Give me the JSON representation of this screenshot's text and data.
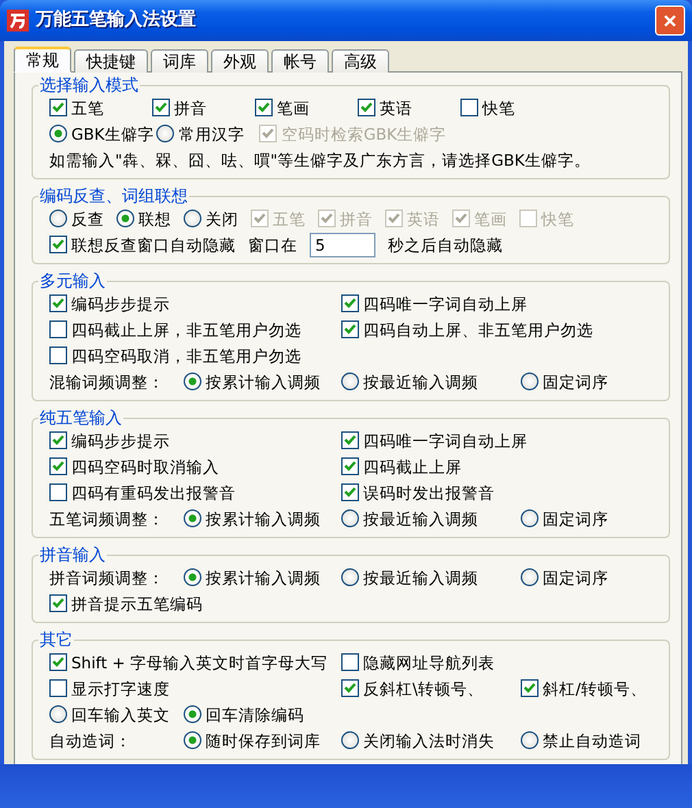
{
  "window": {
    "title": "万能五笔输入法设置",
    "close": "✕"
  },
  "tabs": [
    {
      "label": "常规",
      "selected": true
    },
    {
      "label": "快捷键",
      "selected": false
    },
    {
      "label": "词库",
      "selected": false
    },
    {
      "label": "外观",
      "selected": false
    },
    {
      "label": "帐号",
      "selected": false
    },
    {
      "label": "高级",
      "selected": false
    }
  ],
  "sections": [
    {
      "title": "选择输入模式",
      "kind": "spaced",
      "rows": [
        {
          "items": [
            {
              "kind": "checkbox",
              "label": "五笔",
              "checked": true,
              "disabled": false
            },
            {
              "kind": "checkbox",
              "label": "拼音",
              "checked": true,
              "disabled": false
            },
            {
              "kind": "checkbox",
              "label": "笔画",
              "checked": true,
              "disabled": false
            },
            {
              "kind": "checkbox",
              "label": "英语",
              "checked": true,
              "disabled": false
            },
            {
              "kind": "checkbox",
              "label": "快笔",
              "checked": false,
              "disabled": false
            }
          ]
        },
        {
          "items": [
            {
              "kind": "radio",
              "label": "GBK生僻字",
              "selected": true,
              "disabled": false
            },
            {
              "kind": "radio",
              "label": "常用汉字",
              "selected": false,
              "disabled": false
            },
            {
              "kind": "checkbox",
              "label": "空码时检索GBK生僻字",
              "checked": true,
              "disabled": true
            }
          ]
        },
        {
          "items": [
            {
              "kind": "text",
              "label": "如需输入\"犇、槑、囧、呿、嘪\"等生僻字及广东方言，请选择GBK生僻字。"
            }
          ]
        }
      ]
    },
    {
      "title": "编码反查、词组联想",
      "kind": "flow",
      "rows": [
        {
          "items": [
            {
              "kind": "radio",
              "label": "反查",
              "selected": false,
              "disabled": false
            },
            {
              "kind": "radio",
              "label": "联想",
              "selected": true,
              "disabled": false
            },
            {
              "kind": "radio",
              "label": "关闭",
              "selected": false,
              "disabled": false
            },
            {
              "kind": "checkbox",
              "label": "五笔",
              "checked": true,
              "disabled": true
            },
            {
              "kind": "checkbox",
              "label": "拼音",
              "checked": true,
              "disabled": true
            },
            {
              "kind": "checkbox",
              "label": "英语",
              "checked": true,
              "disabled": true
            },
            {
              "kind": "checkbox",
              "label": "笔画",
              "checked": true,
              "disabled": true
            },
            {
              "kind": "checkbox",
              "label": "快笔",
              "checked": false,
              "disabled": true
            }
          ]
        },
        {
          "items": [
            {
              "kind": "checkbox",
              "label": "联想反查窗口自动隐藏",
              "checked": true,
              "disabled": false
            },
            {
              "kind": "label",
              "label": "窗口在"
            },
            {
              "kind": "field",
              "value": "5"
            },
            {
              "kind": "label",
              "label": "秒之后自动隐藏"
            }
          ]
        }
      ]
    },
    {
      "title": "多元输入",
      "kind": "grid",
      "rows": [
        {
          "items": [
            {
              "kind": "checkbox",
              "label": "编码步步提示",
              "checked": true
            },
            {
              "kind": "checkbox",
              "label": "四码唯一字词自动上屏",
              "checked": true
            }
          ]
        },
        {
          "items": [
            {
              "kind": "checkbox",
              "label": "四码截止上屏，非五笔用户勿选",
              "checked": false
            },
            {
              "kind": "checkbox",
              "label": "四码自动上屏、非五笔用户勿选",
              "checked": true
            }
          ]
        },
        {
          "items": [
            {
              "kind": "checkbox",
              "label": "四码空码取消，非五笔用户勿选",
              "checked": false
            }
          ]
        },
        {
          "items": [
            {
              "kind": "label",
              "label": "混输词频调整："
            },
            {
              "kind": "radio",
              "label": "按累计输入调频",
              "selected": true
            },
            {
              "kind": "radio",
              "label": "按最近输入调频",
              "selected": false
            },
            {
              "kind": "radio",
              "label": "固定词序",
              "selected": false
            }
          ]
        }
      ]
    },
    {
      "title": "纯五笔输入",
      "kind": "grid",
      "rows": [
        {
          "items": [
            {
              "kind": "checkbox",
              "label": "编码步步提示",
              "checked": true
            },
            {
              "kind": "checkbox",
              "label": "四码唯一字词自动上屏",
              "checked": true
            }
          ]
        },
        {
          "items": [
            {
              "kind": "checkbox",
              "label": "四码空码时取消输入",
              "checked": true
            },
            {
              "kind": "checkbox",
              "label": "四码截止上屏",
              "checked": true
            }
          ]
        },
        {
          "items": [
            {
              "kind": "checkbox",
              "label": "四码有重码发出报警音",
              "checked": false
            },
            {
              "kind": "checkbox",
              "label": "误码时发出报警音",
              "checked": true
            }
          ]
        },
        {
          "items": [
            {
              "kind": "label",
              "label": "五笔词频调整："
            },
            {
              "kind": "radio",
              "label": "按累计输入调频",
              "selected": true
            },
            {
              "kind": "radio",
              "label": "按最近输入调频",
              "selected": false
            },
            {
              "kind": "radio",
              "label": "固定词序",
              "selected": false
            }
          ]
        }
      ]
    },
    {
      "title": "拼音输入",
      "kind": "grid",
      "rows": [
        {
          "items": [
            {
              "kind": "label",
              "label": "拼音词频调整："
            },
            {
              "kind": "radio",
              "label": "按累计输入调频",
              "selected": true
            },
            {
              "kind": "radio",
              "label": "按最近输入调频",
              "selected": false
            },
            {
              "kind": "radio",
              "label": "固定词序",
              "selected": false
            }
          ]
        },
        {
          "items": [
            {
              "kind": "checkbox",
              "label": "拼音提示五笔编码",
              "checked": true
            }
          ]
        }
      ]
    },
    {
      "title": "其它",
      "kind": "grid",
      "rows": [
        {
          "items": [
            {
              "kind": "checkbox",
              "label": "Shift + 字母输入英文时首字母大写",
              "checked": true
            },
            {
              "kind": "checkbox",
              "label": "隐藏网址导航列表",
              "checked": false
            }
          ]
        },
        {
          "items": [
            {
              "kind": "checkbox",
              "label": "显示打字速度",
              "checked": false
            },
            {
              "kind": "checkbox",
              "label": "反斜杠\\转顿号、",
              "checked": true
            },
            {
              "kind": "checkbox",
              "label": "斜杠/转顿号、",
              "checked": true
            }
          ]
        },
        {
          "items": [
            {
              "kind": "radio",
              "label": "回车输入英文",
              "selected": false
            },
            {
              "kind": "radio",
              "label": "回车清除编码",
              "selected": true
            }
          ]
        },
        {
          "items": [
            {
              "kind": "label",
              "label": "自动造词："
            },
            {
              "kind": "radio",
              "label": "随时保存到词库",
              "selected": true
            },
            {
              "kind": "radio",
              "label": "关闭输入法时消失",
              "selected": false
            },
            {
              "kind": "radio",
              "label": "禁止自动造词",
              "selected": false
            }
          ]
        }
      ]
    }
  ]
}
